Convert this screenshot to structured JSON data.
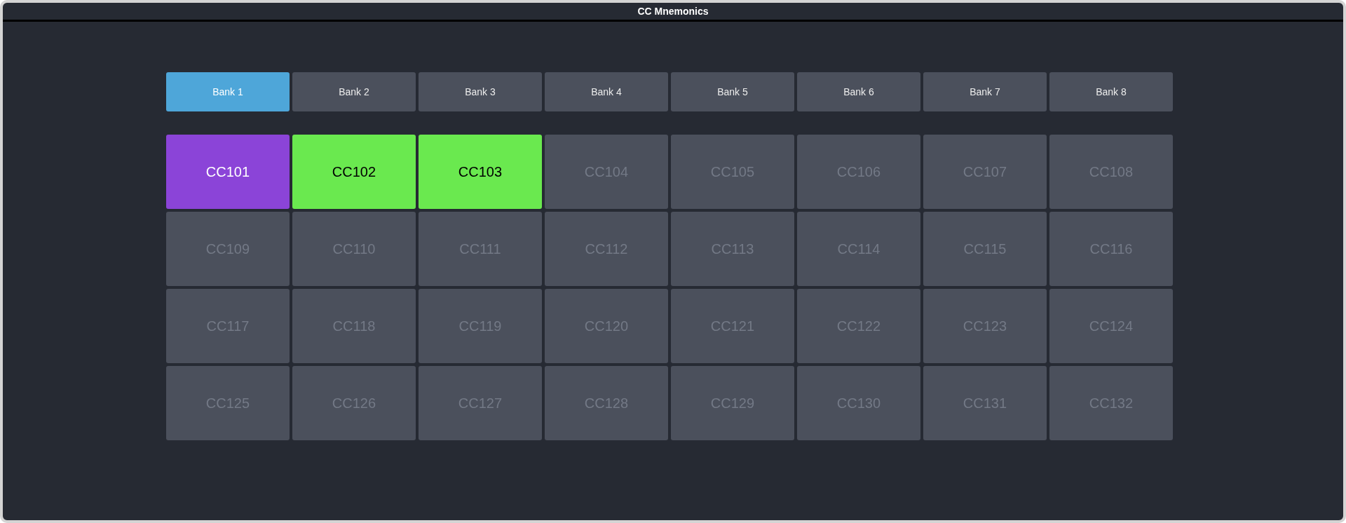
{
  "window": {
    "title": "CC Mnemonics"
  },
  "banks": [
    {
      "label": "Bank 1",
      "selected": true
    },
    {
      "label": "Bank 2",
      "selected": false
    },
    {
      "label": "Bank 3",
      "selected": false
    },
    {
      "label": "Bank 4",
      "selected": false
    },
    {
      "label": "Bank 5",
      "selected": false
    },
    {
      "label": "Bank 6",
      "selected": false
    },
    {
      "label": "Bank 7",
      "selected": false
    },
    {
      "label": "Bank 8",
      "selected": false
    }
  ],
  "cells": [
    {
      "label": "CC101",
      "assigned": true,
      "color": "#8b44d8"
    },
    {
      "label": "CC102",
      "assigned": true,
      "color": "#6ae94f"
    },
    {
      "label": "CC103",
      "assigned": true,
      "color": "#6ae94f"
    },
    {
      "label": "CC104",
      "assigned": false
    },
    {
      "label": "CC105",
      "assigned": false
    },
    {
      "label": "CC106",
      "assigned": false
    },
    {
      "label": "CC107",
      "assigned": false
    },
    {
      "label": "CC108",
      "assigned": false
    },
    {
      "label": "CC109",
      "assigned": false
    },
    {
      "label": "CC110",
      "assigned": false
    },
    {
      "label": "CC111",
      "assigned": false
    },
    {
      "label": "CC112",
      "assigned": false
    },
    {
      "label": "CC113",
      "assigned": false
    },
    {
      "label": "CC114",
      "assigned": false
    },
    {
      "label": "CC115",
      "assigned": false
    },
    {
      "label": "CC116",
      "assigned": false
    },
    {
      "label": "CC117",
      "assigned": false
    },
    {
      "label": "CC118",
      "assigned": false
    },
    {
      "label": "CC119",
      "assigned": false
    },
    {
      "label": "CC120",
      "assigned": false
    },
    {
      "label": "CC121",
      "assigned": false
    },
    {
      "label": "CC122",
      "assigned": false
    },
    {
      "label": "CC123",
      "assigned": false
    },
    {
      "label": "CC124",
      "assigned": false
    },
    {
      "label": "CC125",
      "assigned": false
    },
    {
      "label": "CC126",
      "assigned": false
    },
    {
      "label": "CC127",
      "assigned": false
    },
    {
      "label": "CC128",
      "assigned": false
    },
    {
      "label": "CC129",
      "assigned": false
    },
    {
      "label": "CC130",
      "assigned": false
    },
    {
      "label": "CC131",
      "assigned": false
    },
    {
      "label": "CC132",
      "assigned": false
    }
  ]
}
